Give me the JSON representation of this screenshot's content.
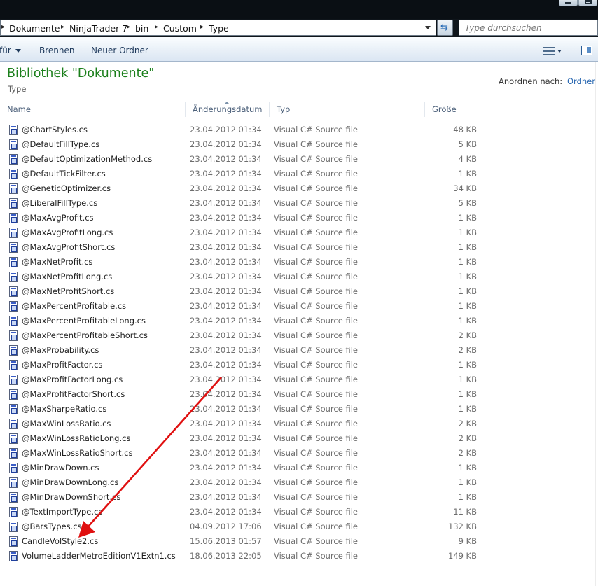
{
  "address": {
    "crumbs": [
      "Dokumente",
      "NinjaTrader 7",
      "bin",
      "Custom",
      "Type"
    ],
    "search_placeholder": "Type durchsuchen"
  },
  "toolbar": {
    "organize_partial": "für",
    "burn": "Brennen",
    "new_folder": "Neuer Ordner"
  },
  "library": {
    "title": "Bibliothek \"Dokumente\"",
    "subtitle": "Type",
    "arrange_label": "Anordnen nach:",
    "arrange_value": "Ordner"
  },
  "columns": {
    "name": "Name",
    "date": "Änderungsdatum",
    "type": "Typ",
    "size": "Größe"
  },
  "files": [
    {
      "name": "@ChartStyles.cs",
      "date": "23.04.2012 01:34",
      "type": "Visual C# Source file",
      "size": "48 KB"
    },
    {
      "name": "@DefaultFillType.cs",
      "date": "23.04.2012 01:34",
      "type": "Visual C# Source file",
      "size": "5 KB"
    },
    {
      "name": "@DefaultOptimizationMethod.cs",
      "date": "23.04.2012 01:34",
      "type": "Visual C# Source file",
      "size": "4 KB"
    },
    {
      "name": "@DefaultTickFilter.cs",
      "date": "23.04.2012 01:34",
      "type": "Visual C# Source file",
      "size": "1 KB"
    },
    {
      "name": "@GeneticOptimizer.cs",
      "date": "23.04.2012 01:34",
      "type": "Visual C# Source file",
      "size": "34 KB"
    },
    {
      "name": "@LiberalFillType.cs",
      "date": "23.04.2012 01:34",
      "type": "Visual C# Source file",
      "size": "5 KB"
    },
    {
      "name": "@MaxAvgProfit.cs",
      "date": "23.04.2012 01:34",
      "type": "Visual C# Source file",
      "size": "1 KB"
    },
    {
      "name": "@MaxAvgProfitLong.cs",
      "date": "23.04.2012 01:34",
      "type": "Visual C# Source file",
      "size": "1 KB"
    },
    {
      "name": "@MaxAvgProfitShort.cs",
      "date": "23.04.2012 01:34",
      "type": "Visual C# Source file",
      "size": "1 KB"
    },
    {
      "name": "@MaxNetProfit.cs",
      "date": "23.04.2012 01:34",
      "type": "Visual C# Source file",
      "size": "1 KB"
    },
    {
      "name": "@MaxNetProfitLong.cs",
      "date": "23.04.2012 01:34",
      "type": "Visual C# Source file",
      "size": "1 KB"
    },
    {
      "name": "@MaxNetProfitShort.cs",
      "date": "23.04.2012 01:34",
      "type": "Visual C# Source file",
      "size": "1 KB"
    },
    {
      "name": "@MaxPercentProfitable.cs",
      "date": "23.04.2012 01:34",
      "type": "Visual C# Source file",
      "size": "1 KB"
    },
    {
      "name": "@MaxPercentProfitableLong.cs",
      "date": "23.04.2012 01:34",
      "type": "Visual C# Source file",
      "size": "1 KB"
    },
    {
      "name": "@MaxPercentProfitableShort.cs",
      "date": "23.04.2012 01:34",
      "type": "Visual C# Source file",
      "size": "2 KB"
    },
    {
      "name": "@MaxProbability.cs",
      "date": "23.04.2012 01:34",
      "type": "Visual C# Source file",
      "size": "2 KB"
    },
    {
      "name": "@MaxProfitFactor.cs",
      "date": "23.04.2012 01:34",
      "type": "Visual C# Source file",
      "size": "1 KB"
    },
    {
      "name": "@MaxProfitFactorLong.cs",
      "date": "23.04.2012 01:34",
      "type": "Visual C# Source file",
      "size": "1 KB"
    },
    {
      "name": "@MaxProfitFactorShort.cs",
      "date": "23.04.2012 01:34",
      "type": "Visual C# Source file",
      "size": "1 KB"
    },
    {
      "name": "@MaxSharpeRatio.cs",
      "date": "23.04.2012 01:34",
      "type": "Visual C# Source file",
      "size": "1 KB"
    },
    {
      "name": "@MaxWinLossRatio.cs",
      "date": "23.04.2012 01:34",
      "type": "Visual C# Source file",
      "size": "2 KB"
    },
    {
      "name": "@MaxWinLossRatioLong.cs",
      "date": "23.04.2012 01:34",
      "type": "Visual C# Source file",
      "size": "2 KB"
    },
    {
      "name": "@MaxWinLossRatioShort.cs",
      "date": "23.04.2012 01:34",
      "type": "Visual C# Source file",
      "size": "2 KB"
    },
    {
      "name": "@MinDrawDown.cs",
      "date": "23.04.2012 01:34",
      "type": "Visual C# Source file",
      "size": "1 KB"
    },
    {
      "name": "@MinDrawDownLong.cs",
      "date": "23.04.2012 01:34",
      "type": "Visual C# Source file",
      "size": "1 KB"
    },
    {
      "name": "@MinDrawDownShort.cs",
      "date": "23.04.2012 01:34",
      "type": "Visual C# Source file",
      "size": "1 KB"
    },
    {
      "name": "@TextImportType.cs",
      "date": "23.04.2012 01:34",
      "type": "Visual C# Source file",
      "size": "11 KB"
    },
    {
      "name": "@BarsTypes.cs",
      "date": "04.09.2012 17:06",
      "type": "Visual C# Source file",
      "size": "132 KB"
    },
    {
      "name": "CandleVolStyle2.cs",
      "date": "15.06.2013 01:57",
      "type": "Visual C# Source file",
      "size": "9 KB"
    },
    {
      "name": "VolumeLadderMetroEditionV1Extn1.cs",
      "date": "18.06.2013 22:05",
      "type": "Visual C# Source file",
      "size": "149 KB"
    }
  ],
  "colors": {
    "library_title": "#1b7f1b",
    "link_blue": "#2766b0",
    "annotation_arrow": "#e01010"
  }
}
